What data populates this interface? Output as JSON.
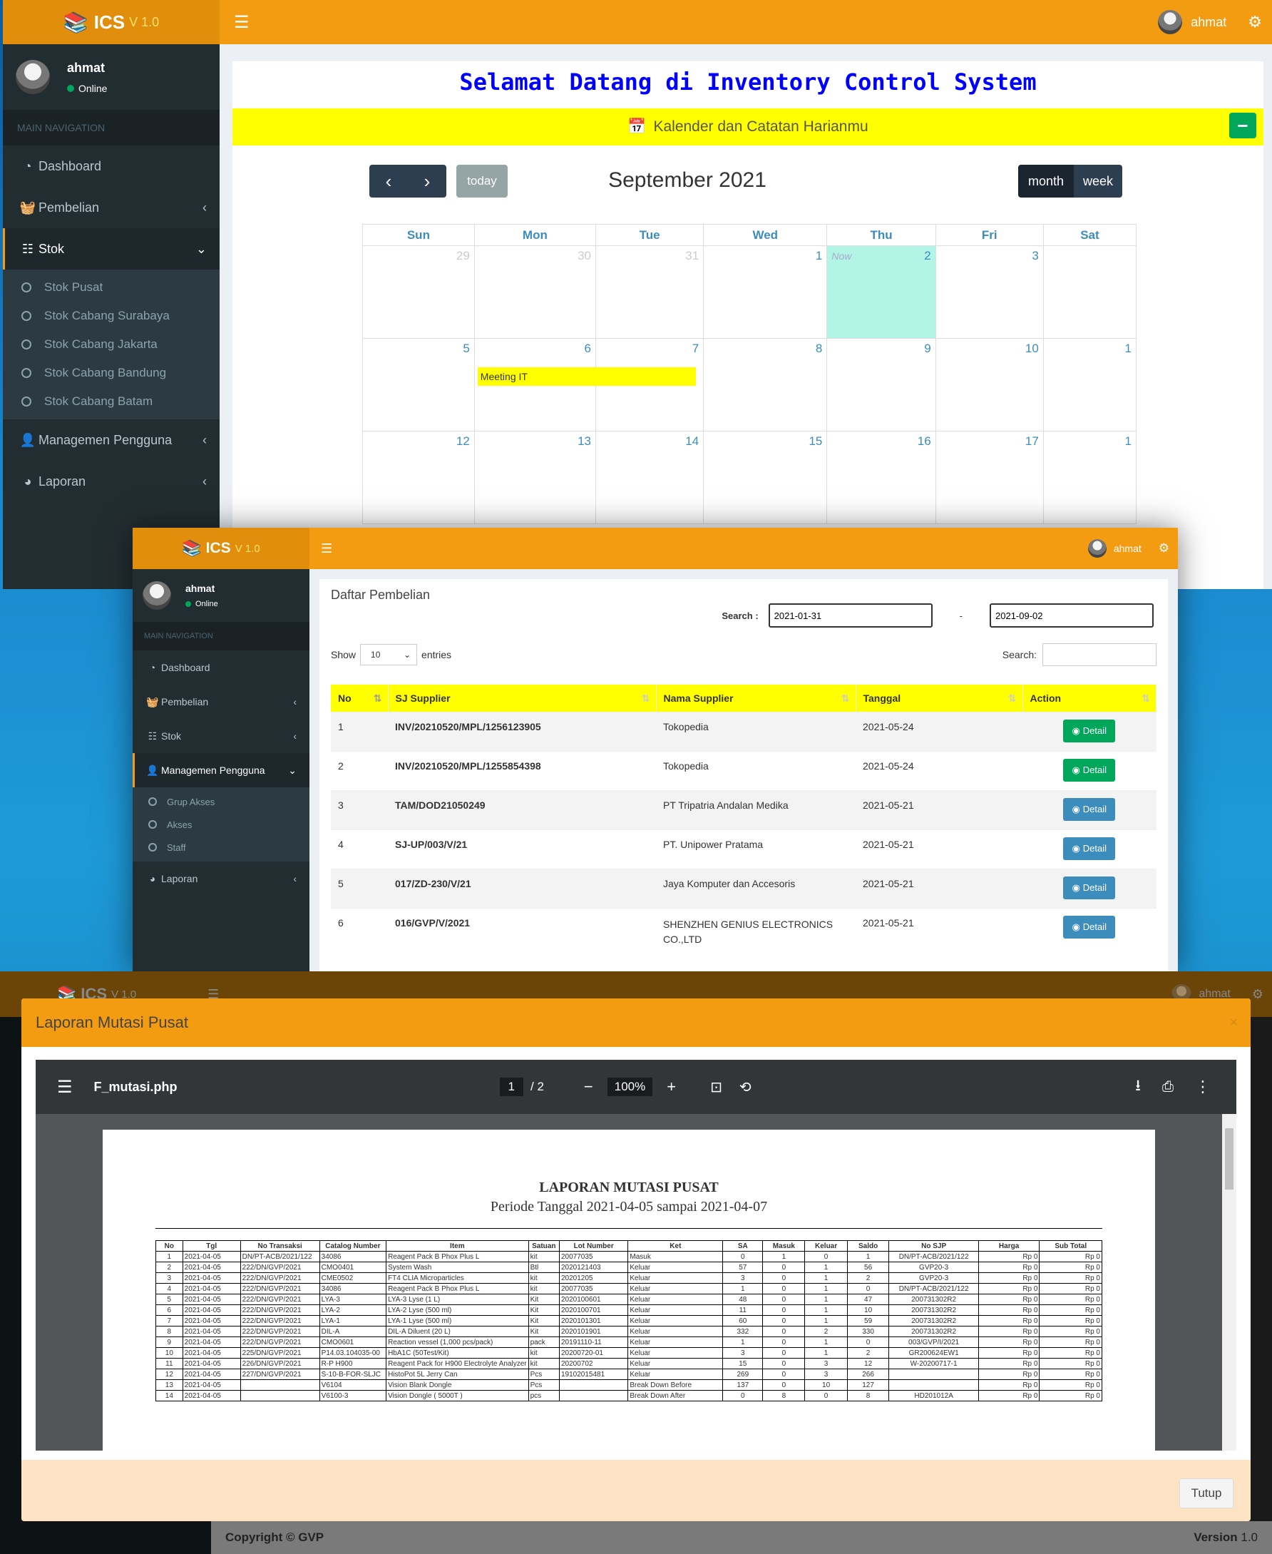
{
  "s1": {
    "logo": "ICS",
    "version": "V 1.0",
    "user": "ahmat",
    "status": "Online",
    "nav_header": "MAIN NAVIGATION",
    "nav": [
      "Dashboard",
      "Pembelian",
      "Stok",
      "Managemen Pengguna",
      "Laporan"
    ],
    "stok_sub": [
      "Stok Pusat",
      "Stok Cabang Surabaya",
      "Stok Cabang Jakarta",
      "Stok Cabang Bandung",
      "Stok Cabang Batam"
    ],
    "welcome": "Selamat Datang di Inventory Control System",
    "box_title": "Kalender dan Catatan Harianmu",
    "cal": {
      "today_btn": "today",
      "title": "September 2021",
      "month_btn": "month",
      "week_btn": "week",
      "days": [
        "Sun",
        "Mon",
        "Tue",
        "Wed",
        "Thu",
        "Fri",
        "Sat"
      ],
      "weeks": [
        [
          "29",
          "30",
          "31",
          "1",
          "2",
          "3",
          ""
        ],
        [
          "5",
          "6",
          "7",
          "8",
          "9",
          "10",
          "1"
        ],
        [
          "12",
          "13",
          "14",
          "15",
          "16",
          "17",
          "1"
        ]
      ],
      "now_label": "Now",
      "event": "Meeting IT"
    }
  },
  "s2": {
    "logo": "ICS",
    "version": "V 1.0",
    "user": "ahmat",
    "status": "Online",
    "nav_header": "MAIN NAVIGATION",
    "nav": [
      "Dashboard",
      "Pembelian",
      "Stok",
      "Managemen Pengguna",
      "Laporan"
    ],
    "mp_sub": [
      "Grup Akses",
      "Akses",
      "Staff"
    ],
    "title": "Daftar Pembelian",
    "search_label": "Search :",
    "date_from": "2021-01-31",
    "date_sep": "-",
    "date_to": "2021-09-02",
    "show": "Show",
    "entries_val": "10",
    "entries": "entries",
    "search2": "Search:",
    "cols": [
      "No",
      "SJ Supplier",
      "Nama Supplier",
      "Tanggal",
      "Action"
    ],
    "detail": "Detail",
    "rows": [
      {
        "no": "1",
        "sj": "INV/20210520/MPL/1256123905",
        "sup": "Tokopedia",
        "tgl": "2021-05-24"
      },
      {
        "no": "2",
        "sj": "INV/20210520/MPL/1255854398",
        "sup": "Tokopedia",
        "tgl": "2021-05-24"
      },
      {
        "no": "3",
        "sj": "TAM/DOD21050249",
        "sup": "PT Tripatria Andalan Medika",
        "tgl": "2021-05-21"
      },
      {
        "no": "4",
        "sj": "SJ-UP/003/V/21",
        "sup": "PT. Unipower Pratama",
        "tgl": "2021-05-21"
      },
      {
        "no": "5",
        "sj": "017/ZD-230/V/21",
        "sup": "Jaya Komputer dan Accesoris",
        "tgl": "2021-05-21"
      },
      {
        "no": "6",
        "sj": "016/GVP/V/2021",
        "sup": "SHENZHEN GENIUS ELECTRONICS CO.,LTD",
        "tgl": "2021-05-21"
      }
    ]
  },
  "s3": {
    "bg_logo": "ICS",
    "bg_version": "V 1.0",
    "bg_user": "ahmat",
    "modal_title": "Laporan Mutasi Pusat",
    "file": "F_mutasi.php",
    "page": "1",
    "pages": "/ 2",
    "zoom": "100%",
    "report_title": "LAPORAN MUTASI PUSAT",
    "report_period": "Periode Tanggal 2021-04-05 sampai 2021-04-07",
    "cols": [
      "No",
      "Tgl",
      "No Transaksi",
      "Catalog Number",
      "Item",
      "Satuan",
      "Lot Number",
      "Ket",
      "SA",
      "Masuk",
      "Keluar",
      "Saldo",
      "No SJP",
      "Harga",
      "Sub Total"
    ],
    "rows": [
      [
        "1",
        "2021-04-05",
        "DN/PT-ACB/2021/122",
        "34086",
        "Reagent Pack B Phox Plus L",
        "kit",
        "20077035",
        "Masuk",
        "0",
        "1",
        "0",
        "1",
        "DN/PT-ACB/2021/122",
        "Rp 0",
        "Rp 0"
      ],
      [
        "2",
        "2021-04-05",
        "222/DN/GVP/2021",
        "CMO0401",
        "System Wash",
        "Btl",
        "2020121403",
        "Keluar",
        "57",
        "0",
        "1",
        "56",
        "GVP20-3",
        "Rp 0",
        "Rp 0"
      ],
      [
        "3",
        "2021-04-05",
        "222/DN/GVP/2021",
        "CME0502",
        "FT4 CLIA Microparticles",
        "kit",
        "20201205",
        "Keluar",
        "3",
        "0",
        "1",
        "2",
        "GVP20-3",
        "Rp 0",
        "Rp 0"
      ],
      [
        "4",
        "2021-04-05",
        "222/DN/GVP/2021",
        "34086",
        "Reagent Pack B Phox Plus L",
        "kit",
        "20077035",
        "Keluar",
        "1",
        "0",
        "1",
        "0",
        "DN/PT-ACB/2021/122",
        "Rp 0",
        "Rp 0"
      ],
      [
        "5",
        "2021-04-05",
        "222/DN/GVP/2021",
        "LYA-3",
        "LYA-3 Lyse (1 L)",
        "Kit",
        "2020100601",
        "Keluar",
        "48",
        "0",
        "1",
        "47",
        "200731302R2",
        "Rp 0",
        "Rp 0"
      ],
      [
        "6",
        "2021-04-05",
        "222/DN/GVP/2021",
        "LYA-2",
        "LYA-2 Lyse (500 ml)",
        "Kit",
        "2020100701",
        "Keluar",
        "11",
        "0",
        "1",
        "10",
        "200731302R2",
        "Rp 0",
        "Rp 0"
      ],
      [
        "7",
        "2021-04-05",
        "222/DN/GVP/2021",
        "LYA-1",
        "LYA-1 Lyse (500 ml)",
        "Kit",
        "2020101301",
        "Keluar",
        "60",
        "0",
        "1",
        "59",
        "200731302R2",
        "Rp 0",
        "Rp 0"
      ],
      [
        "8",
        "2021-04-05",
        "222/DN/GVP/2021",
        "DIL-A",
        "DIL-A Diluent (20 L)",
        "Kit",
        "2020101901",
        "Keluar",
        "332",
        "0",
        "2",
        "330",
        "200731302R2",
        "Rp 0",
        "Rp 0"
      ],
      [
        "9",
        "2021-04-05",
        "222/DN/GVP/2021",
        "CMO0601",
        "Reaction vessel (1,000 pcs/pack)",
        "pack",
        "20191110-11",
        "Keluar",
        "1",
        "0",
        "1",
        "0",
        "003/GVP/I/2021",
        "Rp 0",
        "Rp 0"
      ],
      [
        "10",
        "2021-04-05",
        "225/DN/GVP/2021",
        "P14.03.104035-00",
        "HbA1C (50Test/Kit)",
        "kit",
        "20200720-01",
        "Keluar",
        "3",
        "0",
        "1",
        "2",
        "GR200624EW1",
        "Rp 0",
        "Rp 0"
      ],
      [
        "11",
        "2021-04-05",
        "226/DN/GVP/2021",
        "R-P H900",
        "Reagent Pack for H900 Electrolyte Analyzer",
        "kit",
        "20200702",
        "Keluar",
        "15",
        "0",
        "3",
        "12",
        "W-20200717-1",
        "Rp 0",
        "Rp 0"
      ],
      [
        "12",
        "2021-04-05",
        "227/DN/GVP/2021",
        "S-10-B-FOR-SLJC",
        "HistoPot 5L Jerry Can",
        "Pcs",
        "19102015481",
        "Keluar",
        "269",
        "0",
        "3",
        "266",
        "",
        "Rp 0",
        "Rp 0"
      ],
      [
        "13",
        "2021-04-05",
        "",
        "V6104",
        "Vision Blank Dongle",
        "Pcs",
        "",
        "Break Down Before",
        "137",
        "0",
        "10",
        "127",
        "",
        "Rp 0",
        "Rp 0"
      ],
      [
        "14",
        "2021-04-05",
        "",
        "V6100-3",
        "Vision Dongle ( 5000T )",
        "pcs",
        "",
        "Break Down After",
        "0",
        "8",
        "0",
        "8",
        "HD201012A",
        "Rp 0",
        "Rp 0"
      ]
    ],
    "close_btn": "Tutup",
    "footer_left": "Copyright © GVP",
    "footer_right_b": "Version",
    "footer_right": "1.0"
  }
}
